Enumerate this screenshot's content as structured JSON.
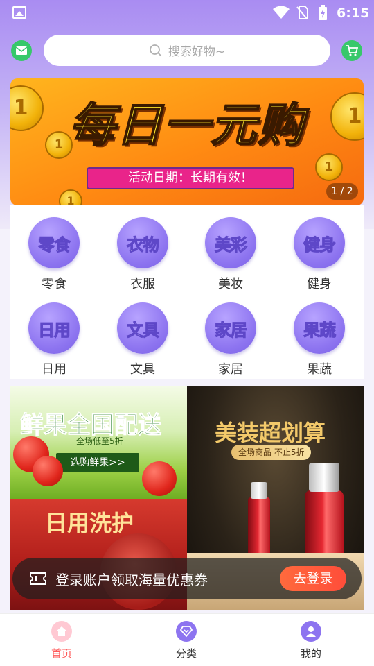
{
  "status_bar": {
    "time": "6:15"
  },
  "search": {
    "placeholder": "搜索好物~"
  },
  "banner": {
    "title": "每日一元购",
    "subtitle": "活动日期：长期有效！",
    "indicator": "1 / 2"
  },
  "categories": [
    {
      "icon_text": "零食",
      "label": "零食"
    },
    {
      "icon_text": "衣物",
      "label": "衣服"
    },
    {
      "icon_text": "美彩",
      "label": "美妆"
    },
    {
      "icon_text": "健身",
      "label": "健身"
    },
    {
      "icon_text": "日用",
      "label": "日用"
    },
    {
      "icon_text": "文具",
      "label": "文具"
    },
    {
      "icon_text": "家居",
      "label": "家居"
    },
    {
      "icon_text": "果蔬",
      "label": "果蔬"
    }
  ],
  "promos": {
    "fruit": {
      "title": "鲜果全国配送",
      "subtitle": "全场低至5折",
      "button": "选购鲜果>>"
    },
    "daily": {
      "title": "日用洗护"
    },
    "beauty": {
      "title": "美装超划算",
      "subtitle": "全场商品  不止5折"
    }
  },
  "login_banner": {
    "text": "登录账户领取海量优惠券",
    "button": "去登录"
  },
  "tabbar": [
    {
      "label": "首页",
      "active": true
    },
    {
      "label": "分类",
      "active": false
    },
    {
      "label": "我的",
      "active": false
    }
  ],
  "colors": {
    "accent": "#8d74f0",
    "active_tab": "#ff5a5a",
    "action": "#37c86a"
  },
  "icons": {
    "message": "mail-icon",
    "cart": "cart-icon",
    "search": "search-icon"
  }
}
